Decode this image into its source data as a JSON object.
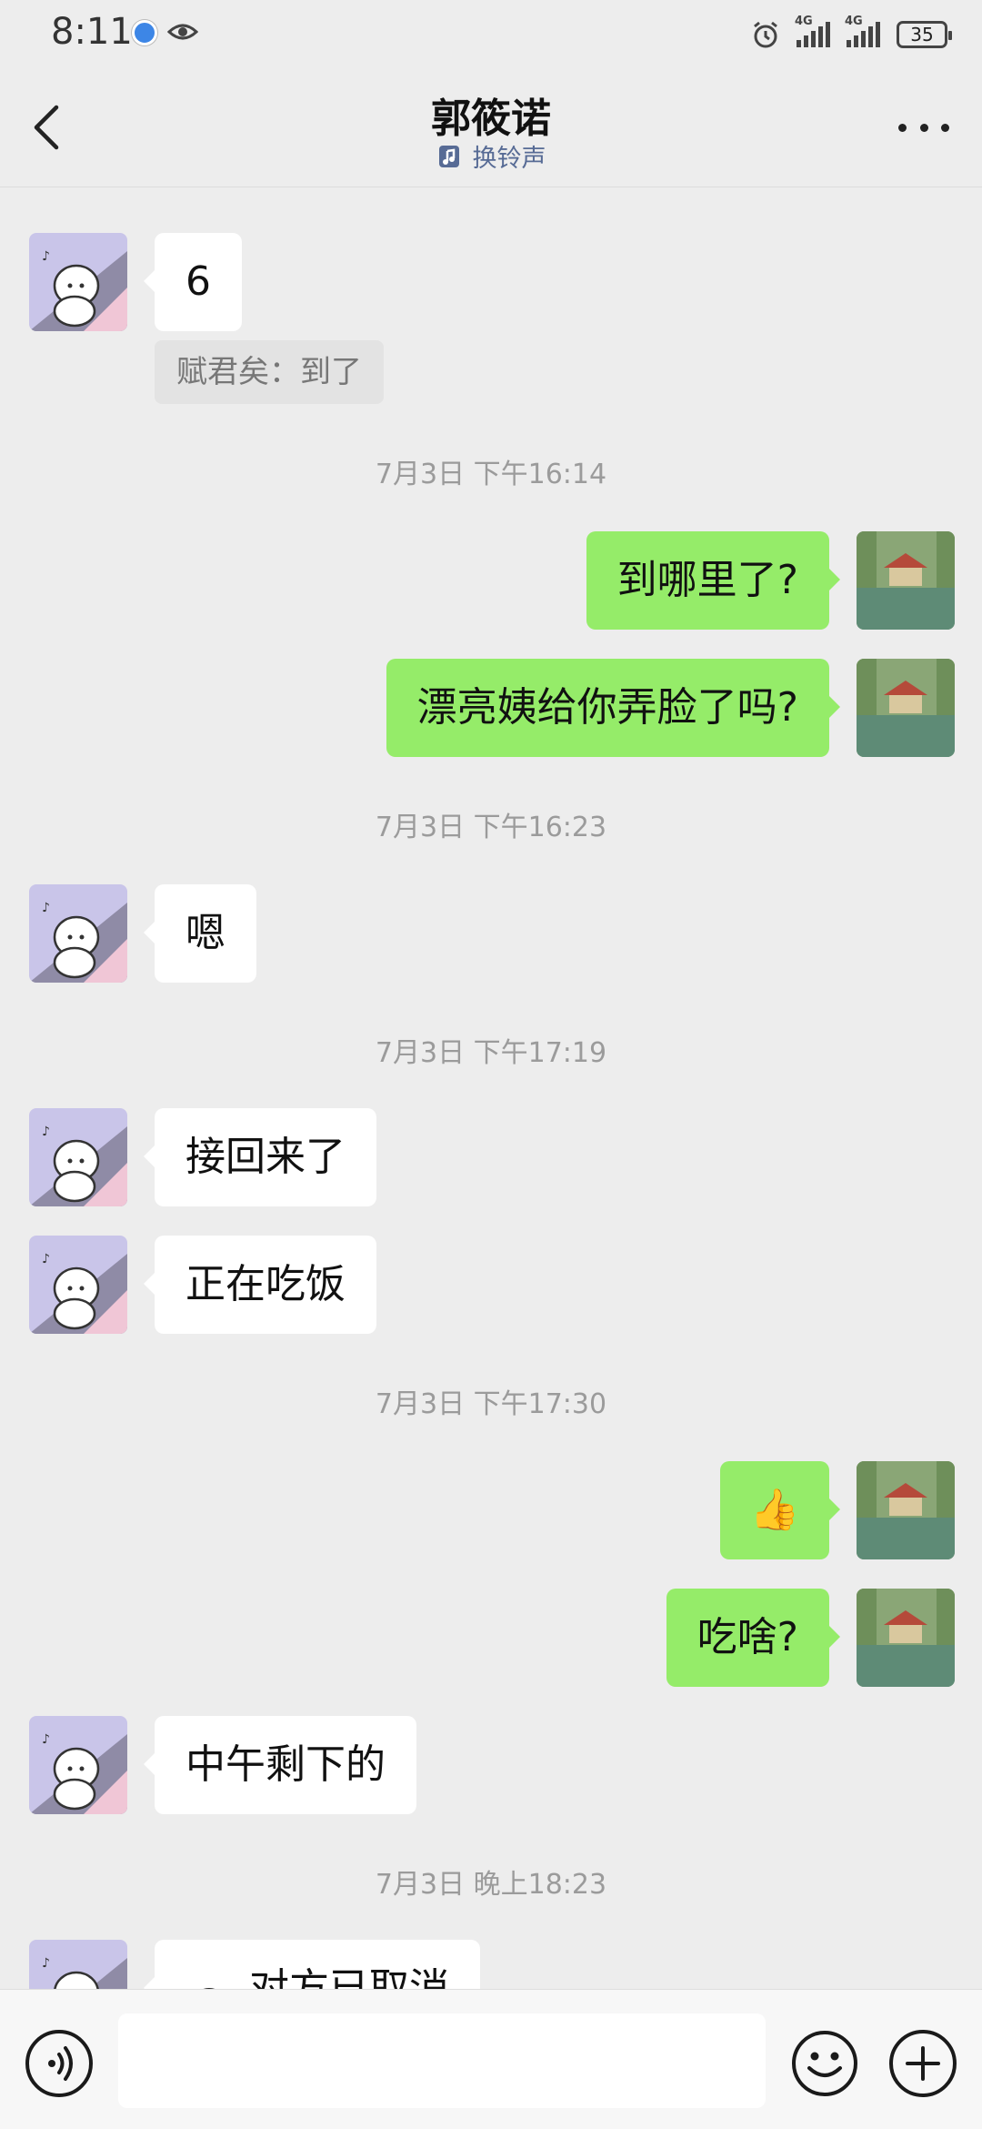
{
  "status_bar": {
    "time": "8:11",
    "network_left": "4G",
    "network_right": "4G",
    "battery": "35"
  },
  "header": {
    "title": "郭筱诺",
    "subtitle": "换铃声"
  },
  "messages": [
    {
      "side": "in",
      "text": "6"
    },
    {
      "quote": "赋君矣：到了"
    },
    {
      "timestamp": "7月3日 下午16:14"
    },
    {
      "side": "out",
      "text": "到哪里了?"
    },
    {
      "side": "out",
      "text": "漂亮姨给你弄脸了吗?"
    },
    {
      "timestamp": "7月3日 下午16:23"
    },
    {
      "side": "in",
      "text": "嗯"
    },
    {
      "timestamp": "7月3日 下午17:19"
    },
    {
      "side": "in",
      "text": "接回来了"
    },
    {
      "side": "in",
      "text": "正在吃饭"
    },
    {
      "timestamp": "7月3日 下午17:30"
    },
    {
      "side": "out",
      "text": "👍"
    },
    {
      "side": "out",
      "text": "吃啥?"
    },
    {
      "side": "in",
      "text": "中午剩下的"
    },
    {
      "timestamp": "7月3日 晚上18:23"
    },
    {
      "side": "in",
      "text": "对方已取消"
    }
  ],
  "input_bar": {
    "placeholder": "",
    "icons": [
      "voice-icon",
      "emoji-icon",
      "plus-icon"
    ]
  },
  "colors": {
    "background": "#ededed",
    "outgoing_bubble": "#95ec69",
    "incoming_bubble": "#ffffff",
    "link_blue": "#576b95"
  }
}
